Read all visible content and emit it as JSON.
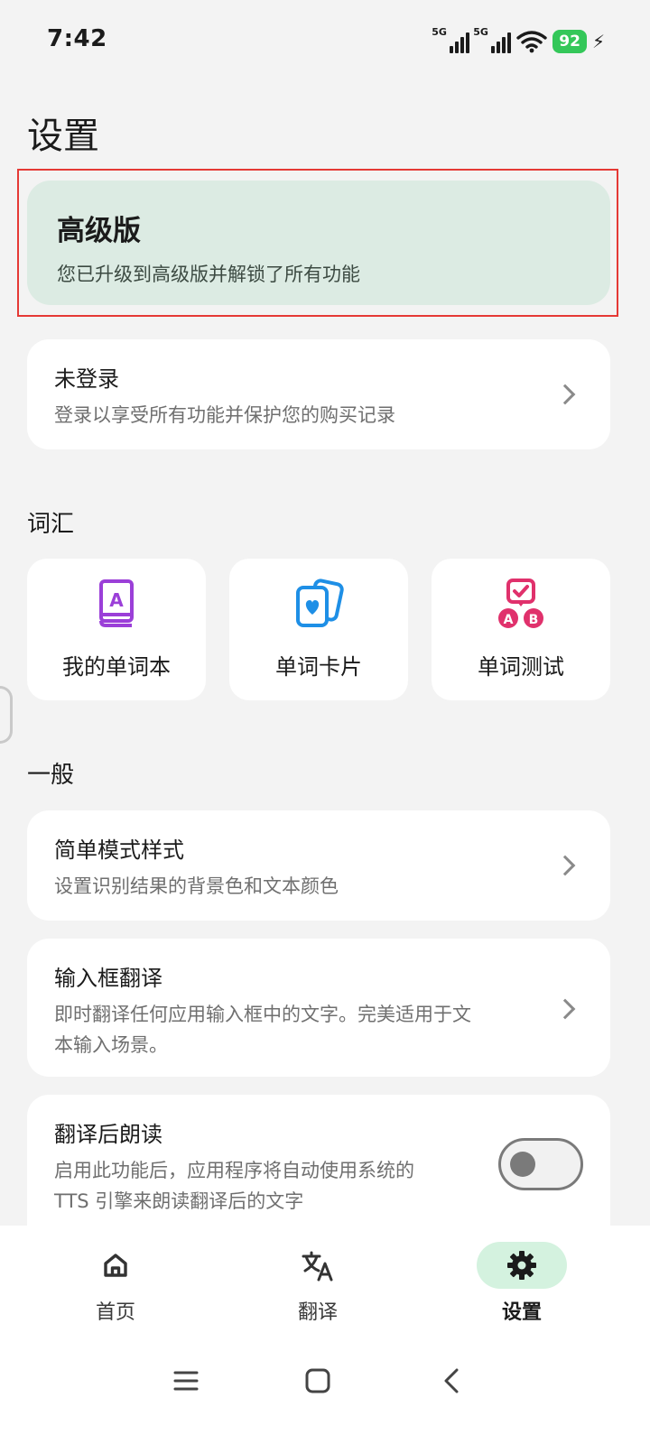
{
  "status_bar": {
    "time": "7:42",
    "signal_label_1": "5G",
    "signal_label_2": "5G",
    "battery": "92",
    "icons": [
      "signal-icon",
      "signal-icon",
      "wifi-icon",
      "battery-icon",
      "charging-icon"
    ]
  },
  "page": {
    "title": "设置"
  },
  "premium": {
    "title": "高级版",
    "description": "您已升级到高级版并解锁了所有功能"
  },
  "account": {
    "title": "未登录",
    "description": "登录以享受所有功能并保护您的购买记录"
  },
  "vocabulary": {
    "section_label": "词汇",
    "tiles": [
      {
        "label": "我的单词本",
        "icon": "book-icon",
        "color": "#9b3fd8"
      },
      {
        "label": "单词卡片",
        "icon": "flashcards-icon",
        "color": "#1e8fe6"
      },
      {
        "label": "单词测试",
        "icon": "quiz-icon",
        "color": "#e0316c"
      }
    ]
  },
  "general": {
    "section_label": "一般",
    "items": [
      {
        "title": "简单模式样式",
        "description": "设置识别结果的背景色和文本颜色"
      },
      {
        "title": "输入框翻译",
        "description_line1": "即时翻译任何应用输入框中的文字。完美适用于文",
        "description_line2": "本输入场景。"
      },
      {
        "title": "翻译后朗读",
        "description_line1": "启用此功能后，应用程序将自动使用系统的",
        "description_line2": "TTS 引擎来朗读翻译后的文字",
        "toggle_on": false
      }
    ]
  },
  "bottom_nav": {
    "items": [
      {
        "label": "首页",
        "icon": "home-icon",
        "active": false
      },
      {
        "label": "翻译",
        "icon": "translate-icon",
        "active": false
      },
      {
        "label": "设置",
        "icon": "gear-icon",
        "active": true
      }
    ],
    "active_color": "#d4f2df"
  },
  "system_nav": {
    "icons": [
      "menu-icon",
      "home-square-icon",
      "back-icon"
    ]
  }
}
